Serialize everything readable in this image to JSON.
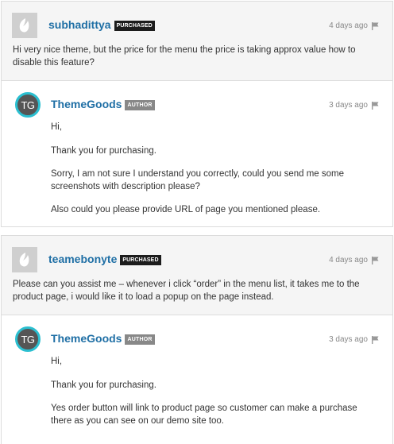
{
  "comments": [
    {
      "question": {
        "author": "subhadittya",
        "badge": "PURCHASED",
        "time": "4 days ago",
        "text": "Hi very nice theme, but the price for the menu the price is taking approx value how to disable this feature?"
      },
      "reply": {
        "avatar_initials": "TG",
        "author": "ThemeGoods",
        "badge": "AUTHOR",
        "time": "3 days ago",
        "paragraphs": [
          "Hi,",
          "Thank you for purchasing.",
          "Sorry, I am not sure I understand you correctly, could you send me some screenshots with description please?",
          "Also could you please provide URL of page you mentioned please."
        ]
      }
    },
    {
      "question": {
        "author": "teamebonyte",
        "badge": "PURCHASED",
        "time": "4 days ago",
        "text": "Please can you assist me – whenever i click “order” in the menu list, it takes me to the product page, i would like it to load a popup on the page instead."
      },
      "reply": {
        "avatar_initials": "TG",
        "author": "ThemeGoods",
        "badge": "AUTHOR",
        "time": "3 days ago",
        "paragraphs": [
          "Hi,",
          "Thank you for purchasing.",
          "Yes order button will link to product page so customer can make a purchase there as you can see on our demo site too."
        ]
      }
    }
  ],
  "icons": {
    "flag": "flag-icon",
    "default_avatar": "envato-leaf-icon"
  },
  "colors": {
    "username": "#1f6fa5",
    "avatar_ring": "#2bbfd0",
    "purchased_badge": "#1c1c1c",
    "author_badge": "#888888"
  }
}
